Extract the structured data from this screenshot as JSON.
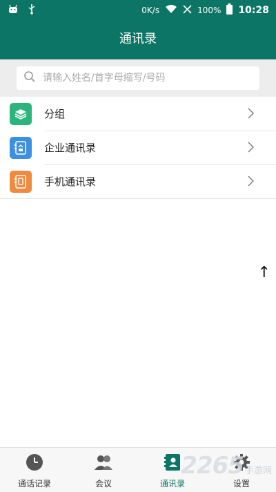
{
  "status_bar": {
    "speed": "0K/s",
    "battery": "100%",
    "time": "10:28"
  },
  "header": {
    "title": "通讯录"
  },
  "search": {
    "placeholder": "请输入姓名/首字母缩写/号码"
  },
  "list": {
    "items": [
      {
        "label": "分组",
        "icon": "layers-icon",
        "color": "#2bb57c"
      },
      {
        "label": "企业通讯录",
        "icon": "company-contacts-icon",
        "color": "#3d8fe0"
      },
      {
        "label": "手机通讯录",
        "icon": "phone-contacts-icon",
        "color": "#f08a3c"
      }
    ]
  },
  "scroll_up": "↑",
  "tabs": [
    {
      "label": "通话记录",
      "icon": "clock-icon"
    },
    {
      "label": "会议",
      "icon": "people-icon"
    },
    {
      "label": "通讯录",
      "icon": "contacts-book-icon",
      "active": true
    },
    {
      "label": "设置",
      "icon": "gear-icon"
    }
  ],
  "watermark": {
    "number": "2265",
    "text": "手游网"
  },
  "colors": {
    "primary": "#0d7565",
    "background": "#ededed"
  }
}
